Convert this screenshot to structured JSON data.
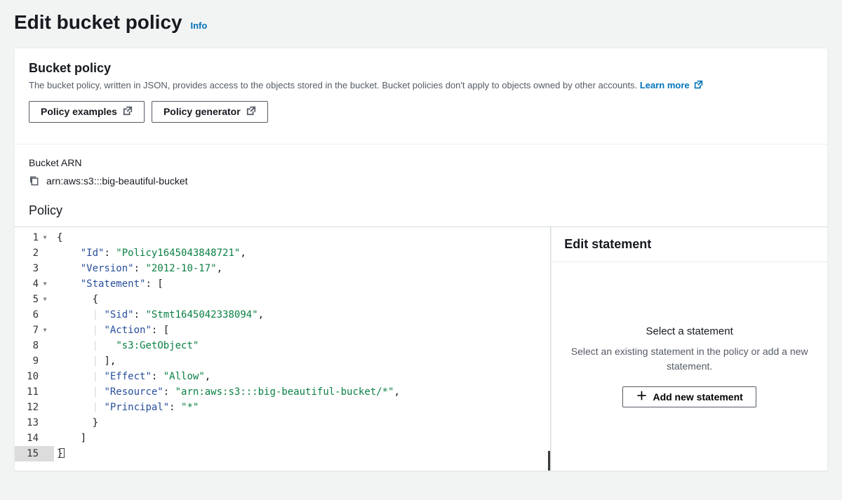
{
  "page": {
    "title": "Edit bucket policy",
    "info": "Info"
  },
  "panel": {
    "title": "Bucket policy",
    "description": "The bucket policy, written in JSON, provides access to the objects stored in the bucket. Bucket policies don't apply to objects owned by other accounts.",
    "learn_more": "Learn more",
    "policy_examples_btn": "Policy examples",
    "policy_generator_btn": "Policy generator"
  },
  "arn": {
    "label": "Bucket ARN",
    "value": "arn:aws:s3:::big-beautiful-bucket"
  },
  "policy": {
    "label": "Policy",
    "json": {
      "Id": "Policy1645043848721",
      "Version": "2012-10-17",
      "Statement": [
        {
          "Sid": "Stmt1645042338094",
          "Action": [
            "s3:GetObject"
          ],
          "Effect": "Allow",
          "Resource": "arn:aws:s3:::big-beautiful-bucket/*",
          "Principal": "*"
        }
      ]
    },
    "lines": [
      {
        "n": 1,
        "fold": true,
        "html": "<span class='tok-punc'>{</span>"
      },
      {
        "n": 2,
        "fold": false,
        "html": "    <span class='tok-key'>\"Id\"</span><span class='tok-punc'>: </span><span class='tok-str'>\"Policy1645043848721\"</span><span class='tok-punc'>,</span>"
      },
      {
        "n": 3,
        "fold": false,
        "html": "    <span class='tok-key'>\"Version\"</span><span class='tok-punc'>: </span><span class='tok-str'>\"2012-10-17\"</span><span class='tok-punc'>,</span>"
      },
      {
        "n": 4,
        "fold": true,
        "html": "    <span class='tok-key'>\"Statement\"</span><span class='tok-punc'>: [</span>"
      },
      {
        "n": 5,
        "fold": true,
        "html": "      <span class='tok-punc'>{</span>"
      },
      {
        "n": 6,
        "fold": false,
        "html": "      <span class='guide'>|</span> <span class='tok-key'>\"Sid\"</span><span class='tok-punc'>: </span><span class='tok-str'>\"Stmt1645042338094\"</span><span class='tok-punc'>,</span>"
      },
      {
        "n": 7,
        "fold": true,
        "html": "      <span class='guide'>|</span> <span class='tok-key'>\"Action\"</span><span class='tok-punc'>: [</span>"
      },
      {
        "n": 8,
        "fold": false,
        "html": "      <span class='guide'>|</span>   <span class='tok-str'>\"s3:GetObject\"</span>"
      },
      {
        "n": 9,
        "fold": false,
        "html": "      <span class='guide'>|</span> <span class='tok-punc'>],</span>"
      },
      {
        "n": 10,
        "fold": false,
        "html": "      <span class='guide'>|</span> <span class='tok-key'>\"Effect\"</span><span class='tok-punc'>: </span><span class='tok-str'>\"Allow\"</span><span class='tok-punc'>,</span>"
      },
      {
        "n": 11,
        "fold": false,
        "html": "      <span class='guide'>|</span> <span class='tok-key'>\"Resource\"</span><span class='tok-punc'>: </span><span class='tok-str'>\"arn:aws:s3:::big-beautiful-bucket/*\"</span><span class='tok-punc'>,</span>"
      },
      {
        "n": 12,
        "fold": false,
        "html": "      <span class='guide'>|</span> <span class='tok-key'>\"Principal\"</span><span class='tok-punc'>: </span><span class='tok-str'>\"*\"</span>"
      },
      {
        "n": 13,
        "fold": false,
        "html": "      <span class='tok-punc'>}</span>"
      },
      {
        "n": 14,
        "fold": false,
        "html": "    <span class='tok-punc'>]</span>"
      },
      {
        "n": 15,
        "fold": false,
        "active": true,
        "html": "<span class='tok-punc'>}</span><span class='cursor-box'></span>"
      }
    ]
  },
  "sidebar": {
    "title": "Edit statement",
    "select_title": "Select a statement",
    "select_hint": "Select an existing statement in the policy or add a new statement.",
    "add_btn": "Add new statement"
  }
}
